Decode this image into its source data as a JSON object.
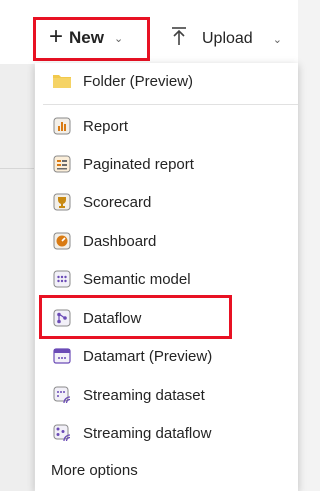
{
  "toolbar": {
    "new_label": "New",
    "upload_label": "Upload"
  },
  "menu": {
    "folder": "Folder (Preview)",
    "items": [
      {
        "label": "Report",
        "icon": "report-icon"
      },
      {
        "label": "Paginated report",
        "icon": "paginated-report-icon"
      },
      {
        "label": "Scorecard",
        "icon": "trophy-icon"
      },
      {
        "label": "Dashboard",
        "icon": "dashboard-gauge-icon"
      },
      {
        "label": "Semantic model",
        "icon": "semantic-model-icon"
      },
      {
        "label": "Dataflow",
        "icon": "dataflow-icon"
      },
      {
        "label": "Datamart (Preview)",
        "icon": "datamart-icon"
      },
      {
        "label": "Streaming dataset",
        "icon": "streaming-dataset-icon"
      },
      {
        "label": "Streaming dataflow",
        "icon": "streaming-dataflow-icon"
      }
    ],
    "more_options": "More options"
  },
  "colors": {
    "highlight": "#e81123",
    "folder_yellow": "#f2c94c",
    "dataflow_purple": "#6b4bb6",
    "orange": "#d97b14"
  }
}
